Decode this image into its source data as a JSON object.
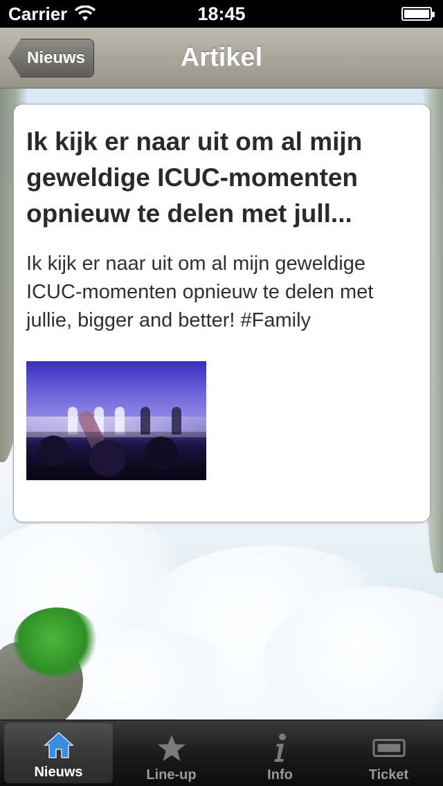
{
  "status_bar": {
    "carrier": "Carrier",
    "time": "18:45"
  },
  "nav_bar": {
    "back_label": "Nieuws",
    "title": "Artikel"
  },
  "article": {
    "title": "Ik kijk er naar uit om al mijn geweldige ICUC-momenten opnieuw te delen met jull...",
    "body": "Ik kijk er naar uit om al mijn geweldige ICUC-momenten opnieuw te delen met jullie, bigger and better! #Family"
  },
  "tab_bar": {
    "selected": "Nieuws",
    "tabs": [
      {
        "label": "Nieuws",
        "icon": "home-icon"
      },
      {
        "label": "Line-up",
        "icon": "star-icon"
      },
      {
        "label": "Info",
        "icon": "info-icon"
      },
      {
        "label": "Ticket",
        "icon": "ticket-icon"
      }
    ]
  },
  "colors": {
    "selected_tab_icon": "#3b8de0",
    "inactive_tab_icon": "#7a7a7a",
    "nav_bar": "#a9a69c"
  }
}
